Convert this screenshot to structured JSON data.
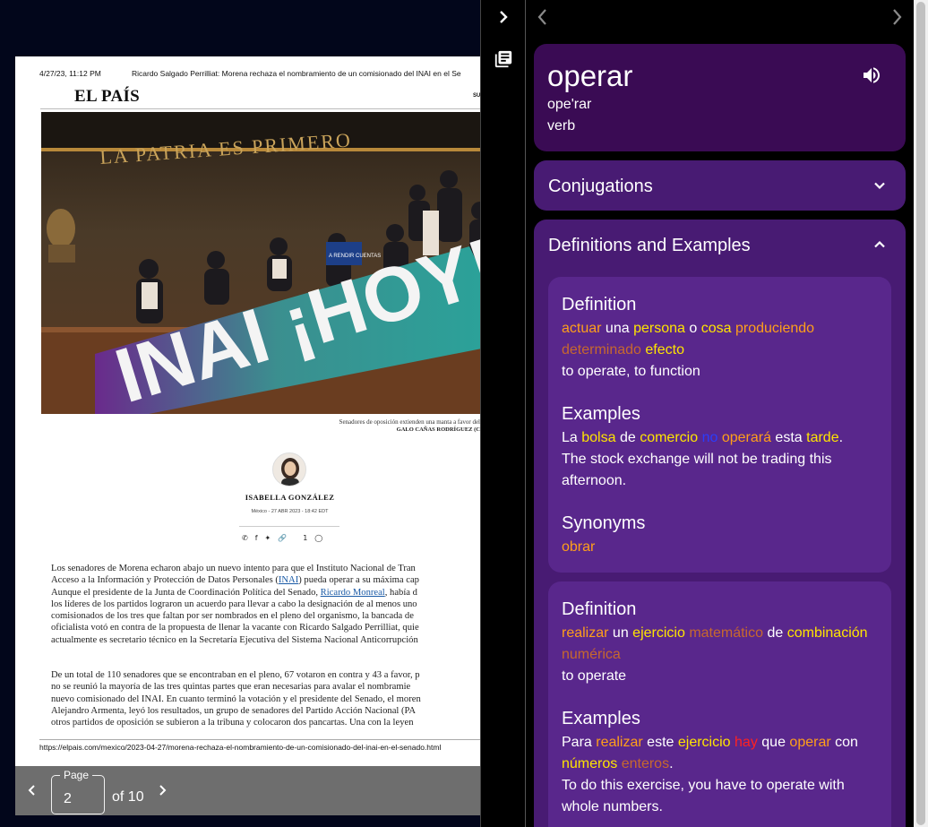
{
  "pdf": {
    "print_date": "4/27/23, 11:12 PM",
    "print_title": "Ricardo Salgado Perrilliat: Morena rechaza el nombramiento de un comisionado del INAI en el Se",
    "masthead": "EL PAÍS",
    "masthead_right": "SU",
    "photo_text_wall": "LA PATRIA ES PRIMERO",
    "photo_banner": "INAI ¡HOY!",
    "photo_sign": "A RENDIR CUENTAS",
    "caption": "Senadores de oposición extienden una manta a favor del",
    "credit": "GALO CAÑAS RODRÍGUEZ (C",
    "author": "ISABELLA GONZÁLEZ",
    "dateline": "México - 27 ABR 2023 - 18:42 EDT",
    "comments_count": "1",
    "para1": {
      "l1": "Los senadores de Morena echaron abajo un nuevo intento para que el Instituto Nacional de Tran",
      "l2a": "Acceso a la Información y Protección de Datos Personales (",
      "l2link": "INAI",
      "l2b": ") pueda operar a su máxima cap",
      "l3a": "Aunque el presidente de la Junta de Coordinación Política del Senado, ",
      "l3link": "Ricardo Monreal",
      "l3b": ", había d",
      "l4": "los líderes de los partidos lograron un acuerdo para llevar a cabo la designación de al menos uno",
      "l5": "comisionados de los tres que faltan por ser nombrados en el pleno del organismo, la bancada de",
      "l6": "oficialista votó en contra de la propuesta de llenar la vacante con Ricardo Salgado Perrilliat, quie",
      "l7": "actualmente es secretario técnico en la Secretaría Ejecutiva del Sistema Nacional Anticorrupción"
    },
    "para2": {
      "l1": "De un total de 110 senadores que se encontraban en el pleno, 67 votaron en contra y 43 a favor, p",
      "l2": "no se reunió la mayoría de las tres quintas partes que eran necesarias para avalar el nombramie",
      "l3": "nuevo comisionado del INAI. En cuanto terminó la votación y el presidente del Senado, el moren",
      "l4": "Alejandro Armenta, leyó los resultados, un grupo de senadores del Partido Acción Nacional (PA",
      "l5": "otros partidos de oposición se subieron a la tribuna y colocaron dos pancartas. Una con la leyen"
    },
    "footer_url": "https://elpais.com/mexico/2023-04-27/morena-rechaza-el-nombramiento-de-un-comisionado-del-inai-en-el-senado.html"
  },
  "pager": {
    "label": "Page",
    "current": "2",
    "total_text": "of 10"
  },
  "entry": {
    "word": "operar",
    "phonetic": "ope'rar",
    "pos": "verb"
  },
  "sections": {
    "conjugations": "Conjugations",
    "definitions": "Definitions and Examples"
  },
  "definitions": [
    {
      "definition_title": "Definition",
      "definition_words": [
        {
          "t": "actuar",
          "c": "o"
        },
        {
          "t": "una",
          "c": "w"
        },
        {
          "t": "persona",
          "c": "y"
        },
        {
          "t": "o",
          "c": "w"
        },
        {
          "t": "cosa",
          "c": "y"
        },
        {
          "t": "produciendo",
          "c": "o"
        },
        {
          "t": "determinado",
          "c": "b"
        },
        {
          "t": "efecto",
          "c": "y"
        }
      ],
      "translation": "to operate, to function",
      "examples_title": "Examples",
      "example_words": [
        {
          "t": "La",
          "c": "w"
        },
        {
          "t": "bolsa",
          "c": "y"
        },
        {
          "t": "de",
          "c": "w"
        },
        {
          "t": "comercio",
          "c": "y"
        },
        {
          "t": "no",
          "c": "n"
        },
        {
          "t": "operará",
          "c": "o"
        },
        {
          "t": "esta",
          "c": "w"
        },
        {
          "t": "tarde",
          "c": "y"
        },
        {
          "t": ".",
          "c": "w"
        }
      ],
      "example_translation": "The stock exchange will not be trading this afternoon.",
      "synonyms_title": "Synonyms",
      "synonyms": [
        {
          "t": "obrar",
          "c": "o"
        }
      ]
    },
    {
      "definition_title": "Definition",
      "definition_words": [
        {
          "t": "realizar",
          "c": "o"
        },
        {
          "t": "un",
          "c": "w"
        },
        {
          "t": "ejercicio",
          "c": "y"
        },
        {
          "t": "matemático",
          "c": "b"
        },
        {
          "t": "de",
          "c": "w"
        },
        {
          "t": "combinación",
          "c": "y"
        },
        {
          "t": "numérica",
          "c": "b"
        }
      ],
      "translation": "to operate",
      "examples_title": "Examples",
      "example_words": [
        {
          "t": "Para",
          "c": "w"
        },
        {
          "t": "realizar",
          "c": "o"
        },
        {
          "t": "este",
          "c": "w"
        },
        {
          "t": "ejercicio",
          "c": "y"
        },
        {
          "t": "hay",
          "c": "r"
        },
        {
          "t": "que",
          "c": "w"
        },
        {
          "t": "operar",
          "c": "o"
        },
        {
          "t": "con",
          "c": "w"
        },
        {
          "t": "números",
          "c": "y"
        },
        {
          "t": "enteros",
          "c": "b"
        },
        {
          "t": ".",
          "c": "w"
        }
      ],
      "example_translation": "To do this exercise, you have to operate with whole numbers."
    }
  ],
  "colors": {
    "word_card": "#3a0b54",
    "section_card": "#481b73",
    "definition_block": "#59278c",
    "highlight_yellow": "#ffe400",
    "highlight_orange": "#ff9f1a",
    "highlight_brown": "#c7682e",
    "highlight_red": "#ff2121",
    "highlight_blue": "#2a3cff"
  }
}
